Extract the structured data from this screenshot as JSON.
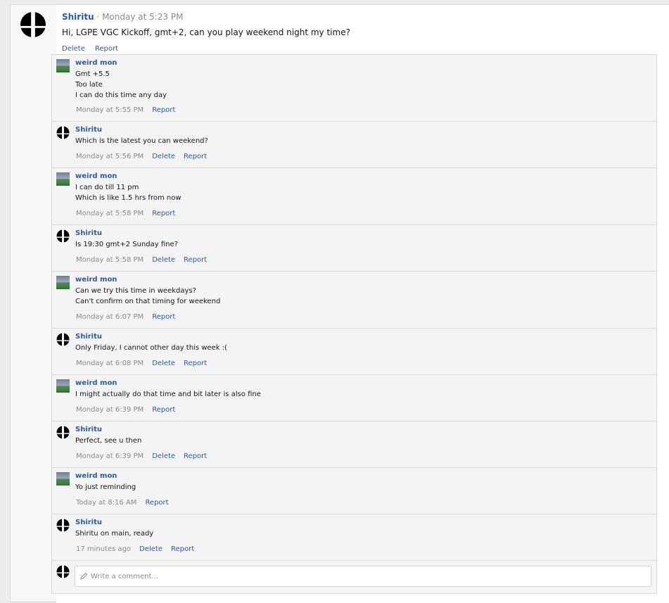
{
  "post": {
    "author": "Shiritu",
    "separator": " · ",
    "time": "Monday at 5:23 PM",
    "text": "Hi, LGPE VGC Kickoff, gmt+2, can you play weekend night my time?",
    "delete_label": "Delete",
    "report_label": "Report"
  },
  "comments": [
    {
      "author": "weird mon",
      "lines": [
        "Gmt +5.5",
        "Too late",
        "I can do this time any day"
      ],
      "time": "Monday at 5:55 PM",
      "report": "Report"
    },
    {
      "author": "Shiritu",
      "lines": [
        "Which is the latest you can weekend?"
      ],
      "time": "Monday at 5:56 PM",
      "delete": "Delete",
      "report": "Report"
    },
    {
      "author": "weird mon",
      "lines": [
        "I can do till 11 pm",
        "Which is like 1.5 hrs from now"
      ],
      "time": "Monday at 5:58 PM",
      "report": "Report"
    },
    {
      "author": "Shiritu",
      "lines": [
        "Is 19:30 gmt+2 Sunday fine?"
      ],
      "time": "Monday at 5:58 PM",
      "delete": "Delete",
      "report": "Report"
    },
    {
      "author": "weird mon",
      "lines": [
        "Can we try this time in weekdays?",
        "Can't confirm on that timing for weekend"
      ],
      "time": "Monday at 6:07 PM",
      "report": "Report"
    },
    {
      "author": "Shiritu",
      "lines": [
        "Only Friday, I cannot other day this week :("
      ],
      "time": "Monday at 6:08 PM",
      "delete": "Delete",
      "report": "Report"
    },
    {
      "author": "weird mon",
      "lines": [
        "I might actually do that time and bit later is also fine"
      ],
      "time": "Monday at 6:39 PM",
      "report": "Report"
    },
    {
      "author": "Shiritu",
      "lines": [
        "Perfect, see u then"
      ],
      "time": "Monday at 6:39 PM",
      "delete": "Delete",
      "report": "Report"
    },
    {
      "author": "weird mon",
      "lines": [
        "Yo just reminding"
      ],
      "time": "Today at 8:16 AM",
      "report": "Report"
    },
    {
      "author": "Shiritu",
      "lines": [
        "Shiritu on main, ready"
      ],
      "time": "17 minutes ago",
      "delete": "Delete",
      "report": "Report"
    }
  ],
  "comment_form": {
    "placeholder": "Write a comment...",
    "pencil_icon": "pencil-icon"
  },
  "icons": {
    "shiritu_avatar": "smash-ball-icon",
    "weird_mon_avatar": "stadium-photo"
  },
  "colors": {
    "link": "#2e5a9b",
    "meta": "#8a8a8a",
    "comment_bg": "#f4f4f4"
  }
}
